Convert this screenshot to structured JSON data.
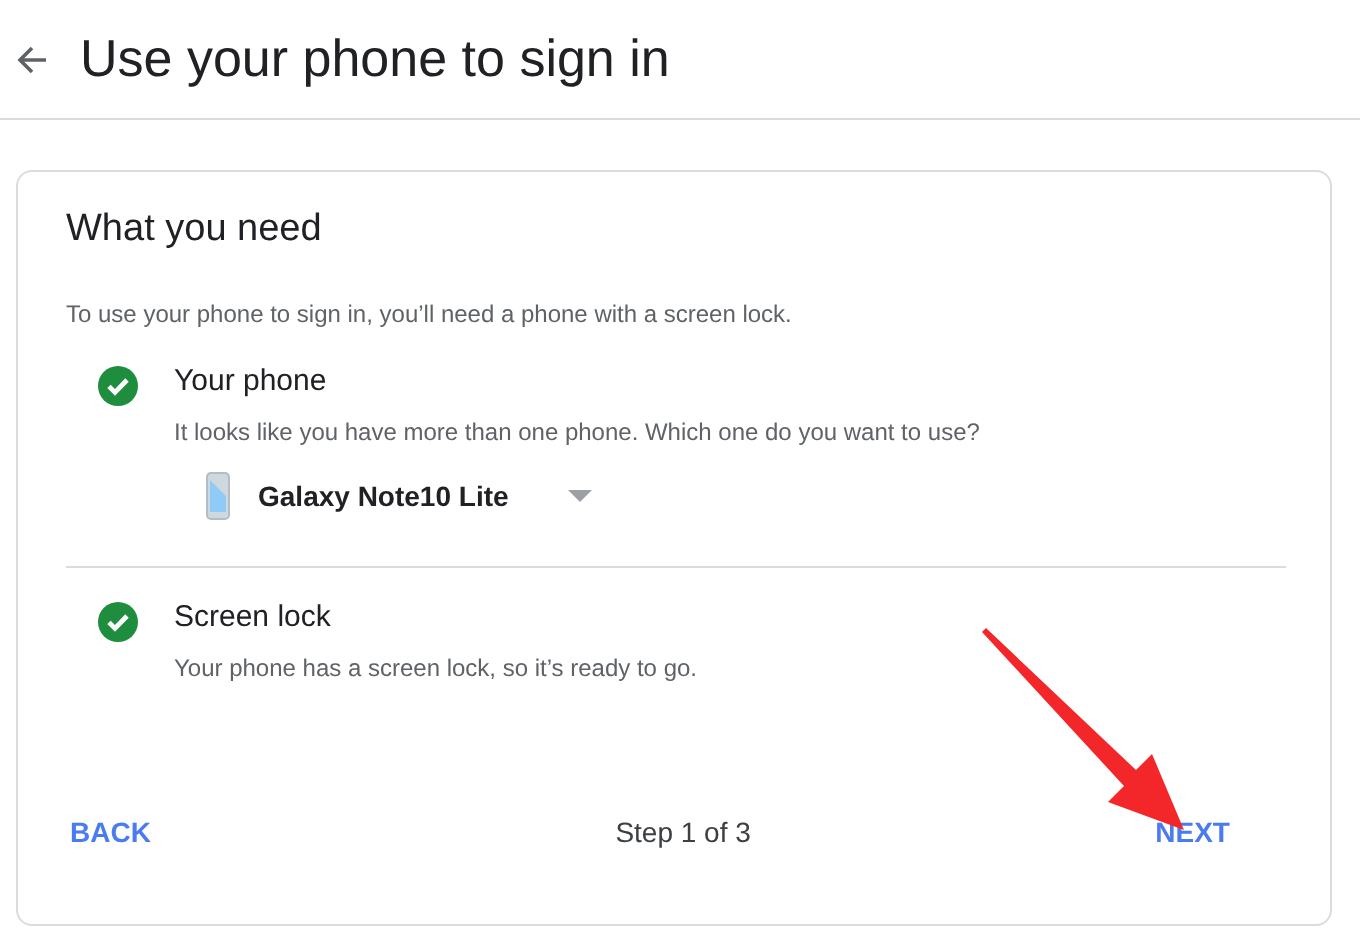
{
  "header": {
    "title": "Use your phone to sign in"
  },
  "card": {
    "title": "What you need",
    "intro": "To use your phone to sign in, you’ll need a phone with a screen lock.",
    "requirements": [
      {
        "title": "Your phone",
        "description": "It looks like you have more than one phone. Which one do you want to use?",
        "met": true,
        "device": "Galaxy Note10 Lite"
      },
      {
        "title": "Screen lock",
        "description": "Your phone has a screen lock, so it’s ready to go.",
        "met": true
      }
    ],
    "footer": {
      "back": "BACK",
      "step": "Step 1 of 3",
      "next": "NEXT"
    }
  }
}
